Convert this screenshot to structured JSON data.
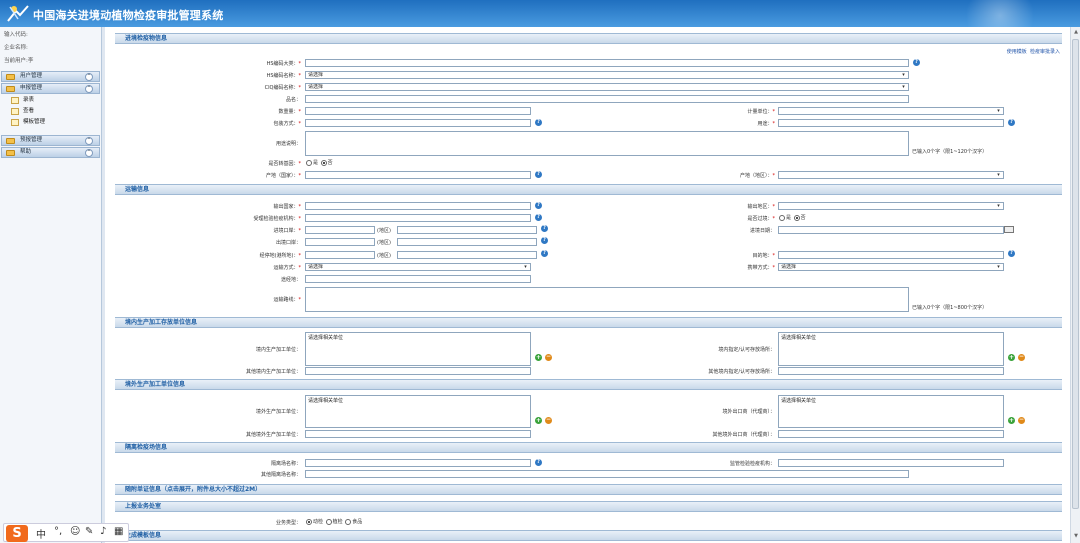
{
  "app": {
    "title": "中国海关进境动植物检疫审批管理系统"
  },
  "sidebar": {
    "info": [
      "输入代码:",
      "企业名称:",
      "当前用户:李"
    ],
    "menus": [
      {
        "label": "用户管理",
        "toggle": "⌃"
      },
      {
        "label": "申报管理",
        "toggle": "⌃",
        "items": [
          "录表",
          "查看",
          "模板管理"
        ]
      },
      {
        "label": "预报管理",
        "toggle": "⌃"
      },
      {
        "label": "帮助",
        "toggle": "⌃"
      }
    ]
  },
  "links": {
    "use_template": "使用模板",
    "batch_create": "检疫审批录入"
  },
  "sections": {
    "goods": "进境检疫物信息",
    "transport": "运输信息",
    "domestic_unit": "境内生产加工存放单位信息",
    "foreign_unit": "境外生产加工单位信息",
    "quarantine": "隔离检疫场信息",
    "attachments": "随附单证信息（点击展开，附件总大小不超过2M）",
    "business_office": "上报业务处室",
    "template": "生成模板信息"
  },
  "goods": {
    "hs_category": "HS编码大类：",
    "hs_name": "HS编码名称：",
    "hs_name_value": "请选择",
    "ciq_name": "CIQ编码名称：",
    "ciq_name_value": "请选择",
    "product_name": "品名：",
    "quantity": "数重量：",
    "unit": "计量单位：",
    "packaging": "包装方式：",
    "usage": "用途：",
    "usage_desc": "用途说明：",
    "usage_hint": "已输入0个字（限1~120个汉字）",
    "quarantine_area": "是否转基因：",
    "yes": "是",
    "no": "否",
    "origin_country": "产地（国家）：",
    "origin_region": "产地（地区）："
  },
  "transport": {
    "export_country": "输出国家：",
    "export_region": "输出地区：",
    "inspect_org": "受理检验检疫机构：",
    "transit": "是否过境：",
    "yes": "是",
    "no": "否",
    "entry_port": "进境口岸：",
    "region_tag": "(地区)",
    "entry_date": "进境日期：",
    "exit_port": "出境口岸：",
    "transit_port": "经停地(港所地)：",
    "destination": "目的地：",
    "transport_mode": "运输方式：",
    "transport_mode_value": "请选择",
    "carry_mode": "携带方式：",
    "carry_mode_value": "请选择",
    "via_place": "途经地：",
    "route": "运输路线：",
    "route_hint": "已输入0个字（限1~800个汉字）"
  },
  "domestic": {
    "unit": "境内生产加工单位：",
    "unit_placeholder": "请选择相关单位",
    "other_unit": "其他境内生产加工单位：",
    "store": "境内指定/认可存放场所：",
    "store_placeholder": "请选择相关单位",
    "other_store": "其他境内指定/认可存放场所："
  },
  "foreign": {
    "unit": "境外生产加工单位：",
    "unit_placeholder": "请选择相关单位",
    "other_unit": "其他境外生产加工单位：",
    "exporter": "境外出口商（代理商）：",
    "exporter_placeholder": "请选择相关单位",
    "other_exporter": "其他境外出口商（代理商）："
  },
  "quarantine": {
    "site": "隔离场名称：",
    "org": "监管检验检疫机构：",
    "other_site": "其他隔离场名称："
  },
  "business": {
    "type_label": "业务类型：",
    "options": [
      "动检",
      "植检",
      "食品"
    ]
  },
  "ime": {
    "logo": "S",
    "lang": "中"
  },
  "colors": {
    "header": "#2a7ccb",
    "section_text": "#1f5fa4",
    "required": "#d10000"
  }
}
